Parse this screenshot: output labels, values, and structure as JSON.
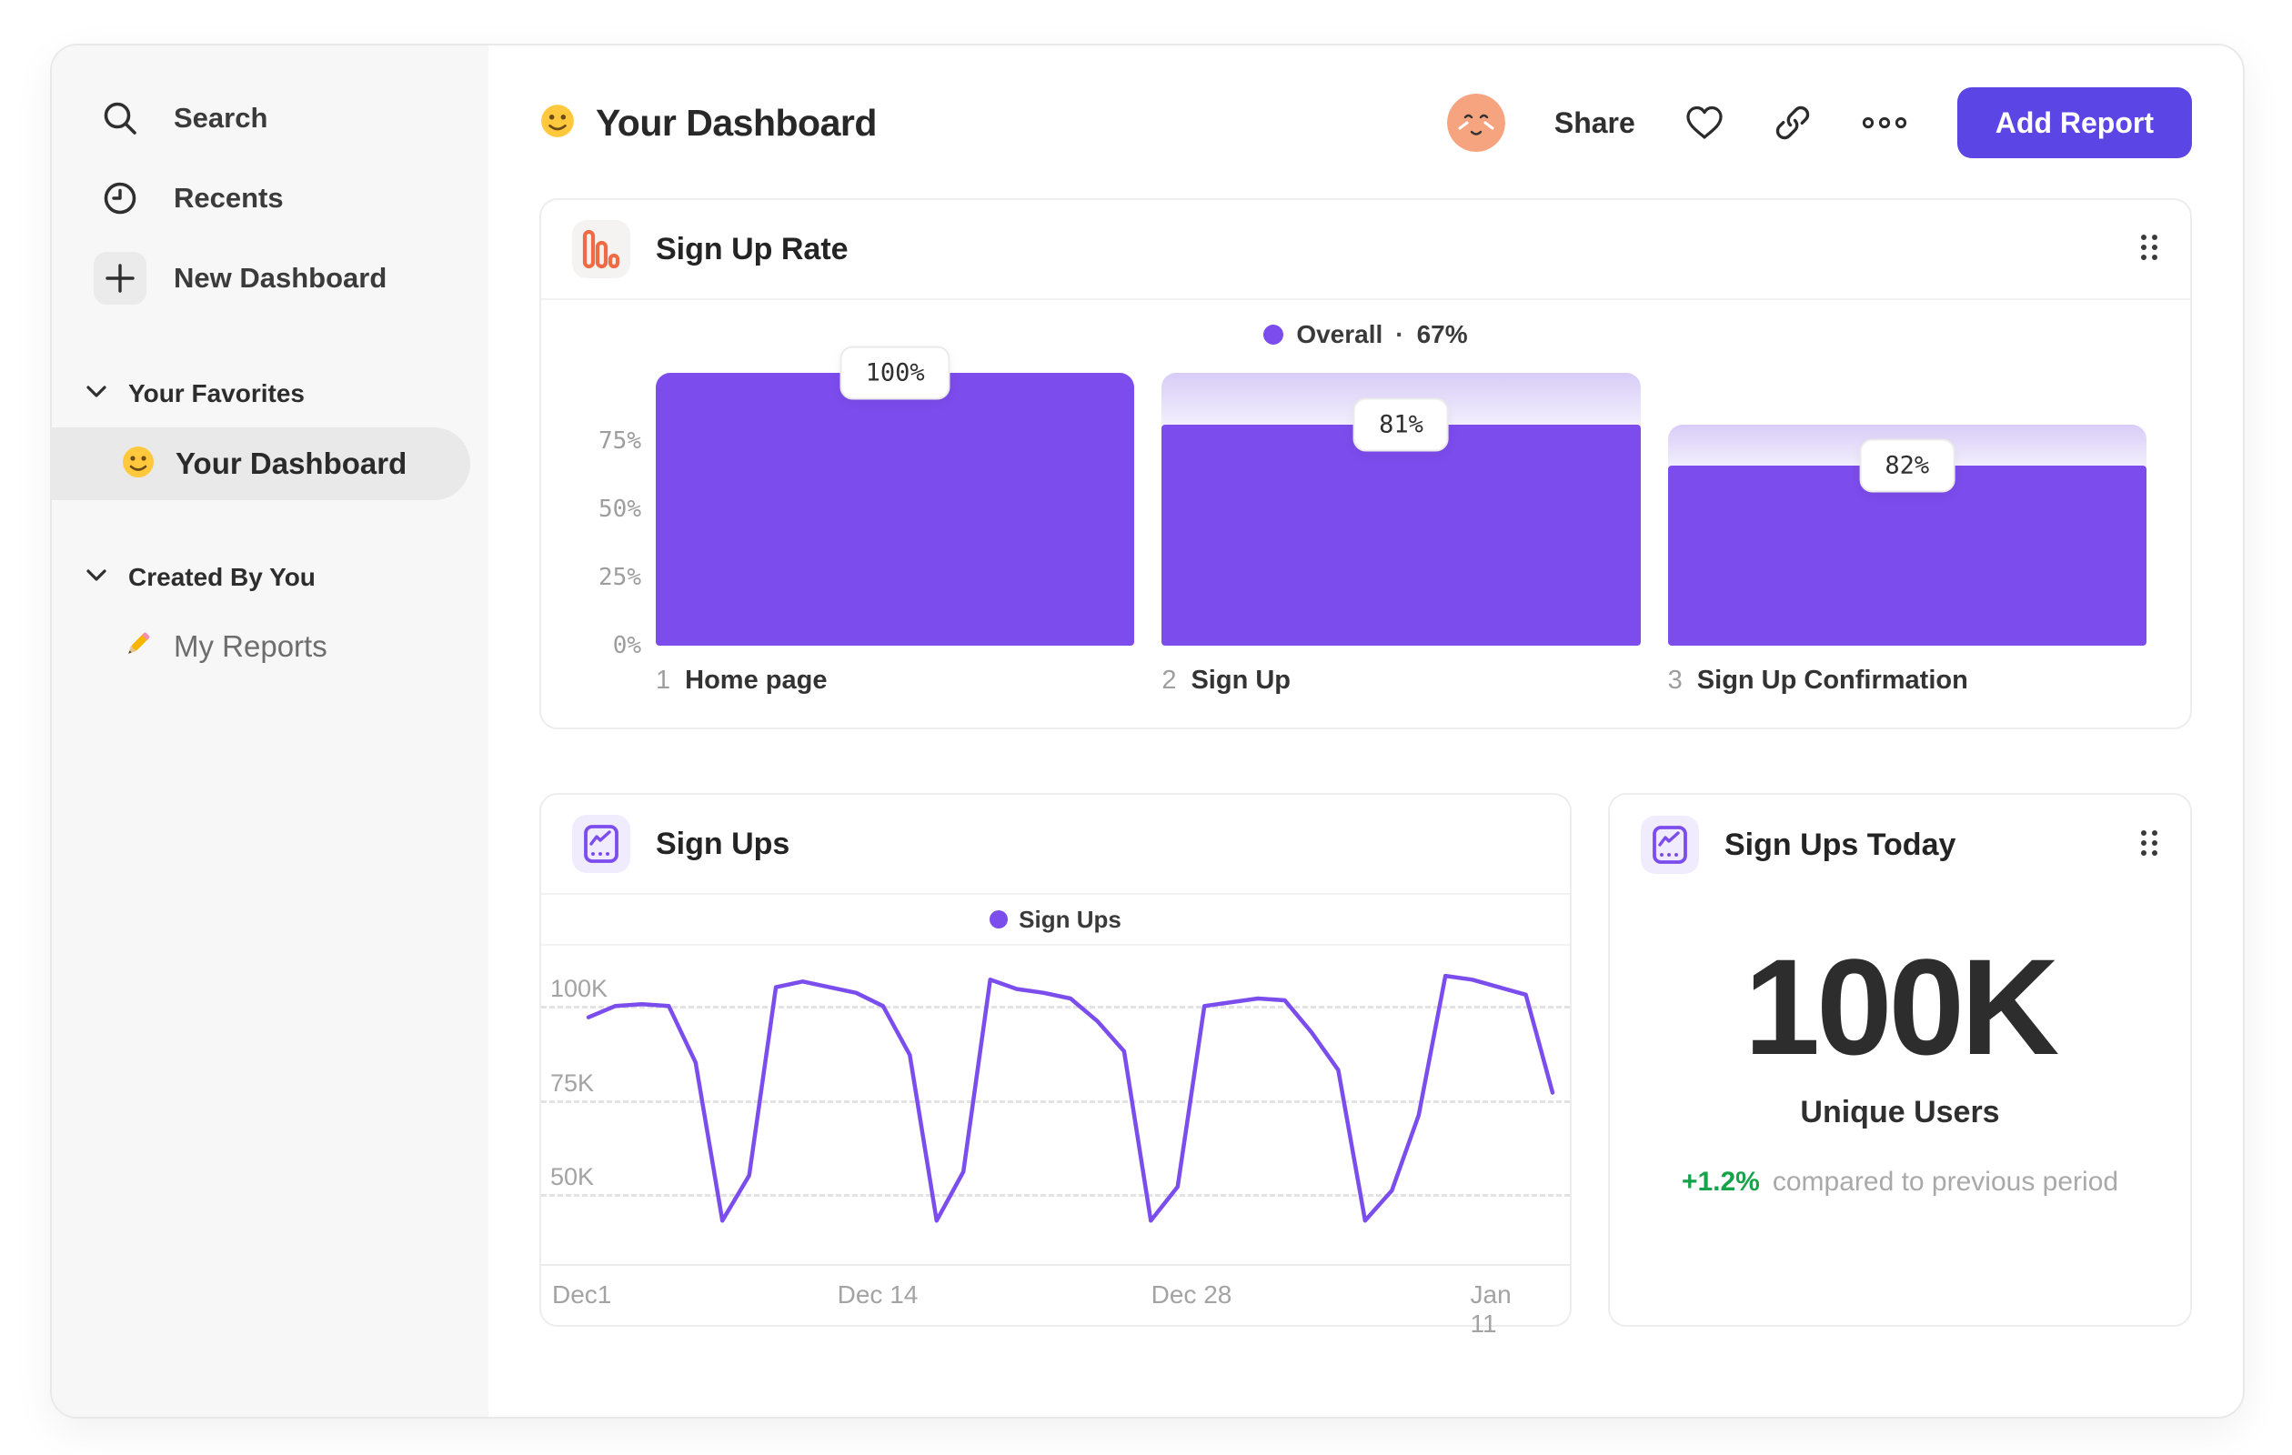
{
  "sidebar": {
    "items": [
      {
        "icon": "search-icon",
        "label": "Search"
      },
      {
        "icon": "clock-icon",
        "label": "Recents"
      },
      {
        "icon": "plus-icon",
        "label": "New Dashboard"
      }
    ],
    "sections": [
      {
        "title": "Your Favorites",
        "icon": "chevron-down-icon",
        "items": [
          {
            "icon": "smiley-icon",
            "label": "Your Dashboard",
            "selected": true
          }
        ]
      },
      {
        "title": "Created By You",
        "icon": "chevron-down-icon",
        "items": [
          {
            "icon": "pencil-icon",
            "label": "My Reports"
          }
        ]
      }
    ]
  },
  "header": {
    "title_icon": "smiley-icon",
    "title": "Your Dashboard",
    "avatar": "user-avatar",
    "share_label": "Share",
    "action_icons": [
      "heart-icon",
      "link-icon",
      "ellipsis-icon"
    ],
    "add_report_label": "Add Report",
    "accent_color": "#5B45E4"
  },
  "chart_data": [
    {
      "type": "bar",
      "variant": "funnel",
      "title": "Sign Up Rate",
      "header_icon": "bar-chart-icon",
      "legend": {
        "name": "Overall",
        "separator": "·",
        "value": "67%"
      },
      "color": "#7C4CEC",
      "ghost_gradient_top": "#D8CCF7",
      "ymax": 100,
      "grid": false,
      "y_ticks": [
        {
          "label": "75%",
          "value": 75
        },
        {
          "label": "50%",
          "value": 50
        },
        {
          "label": "25%",
          "value": 25
        },
        {
          "label": "0%",
          "value": 0
        }
      ],
      "steps": [
        {
          "index": "1",
          "label": "Home page",
          "badge": "100%",
          "conversion_pct": 100,
          "solid_pct": 100,
          "ghost_pct": 100
        },
        {
          "index": "2",
          "label": "Sign Up",
          "badge": "81%",
          "conversion_pct": 81,
          "solid_pct": 81,
          "ghost_pct": 100
        },
        {
          "index": "3",
          "label": "Sign Up Confirmation",
          "badge": "82%",
          "conversion_pct": 82,
          "solid_pct": 66,
          "ghost_pct": 81
        }
      ]
    },
    {
      "type": "line",
      "title": "Sign Ups",
      "header_icon": "line-chart-icon",
      "legend": "Sign Ups",
      "color": "#7B4DED",
      "unit": "K",
      "ymin": 31,
      "ymax": 116,
      "grid": "dashed-horizontal",
      "legend_position": "top-center",
      "y_ticks": [
        {
          "label": "100K",
          "value": 100
        },
        {
          "label": "75K",
          "value": 75
        },
        {
          "label": "50K",
          "value": 50
        }
      ],
      "x_ticks": [
        {
          "label": "Dec1",
          "frac": 0,
          "align": "left"
        },
        {
          "label": "Dec 14",
          "frac": 0.3
        },
        {
          "label": "Dec 28",
          "frac": 0.625
        },
        {
          "label": "Jan 11",
          "frac": 0.949
        }
      ],
      "values": [
        97,
        100,
        100.5,
        100,
        85,
        43,
        55,
        105,
        106.5,
        105,
        103.5,
        100,
        87,
        43,
        56,
        107,
        104.5,
        103.5,
        102,
        96,
        88,
        43,
        52,
        100,
        101,
        102,
        101.5,
        93,
        83,
        43,
        51,
        71,
        108,
        107,
        105,
        103,
        77
      ]
    },
    {
      "type": "kpi",
      "title": "Sign Ups Today",
      "header_icon": "line-chart-icon",
      "value": "100K",
      "label": "Unique Users",
      "delta": "+1.2%",
      "delta_color": "#16A34A",
      "note": "compared to previous period"
    }
  ]
}
